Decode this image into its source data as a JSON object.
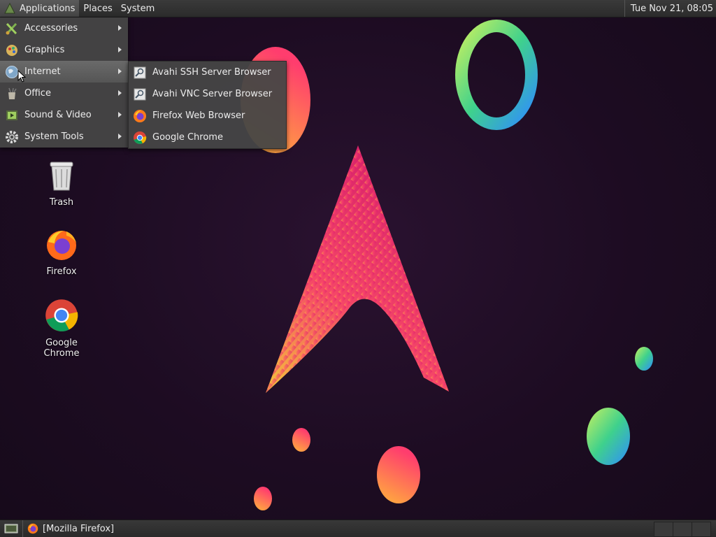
{
  "top_panel": {
    "menus": [
      {
        "label": "Applications",
        "active": true
      },
      {
        "label": "Places"
      },
      {
        "label": "System"
      }
    ],
    "clock": "Tue Nov 21, 08:05"
  },
  "applications_menu": {
    "items": [
      {
        "label": "Accessories",
        "icon": "accessories-icon"
      },
      {
        "label": "Graphics",
        "icon": "graphics-icon"
      },
      {
        "label": "Internet",
        "icon": "internet-globe-icon",
        "active": true
      },
      {
        "label": "Office",
        "icon": "office-icon"
      },
      {
        "label": "Sound & Video",
        "icon": "sound-video-icon"
      },
      {
        "label": "System Tools",
        "icon": "system-tools-gear-icon"
      }
    ]
  },
  "internet_submenu": {
    "items": [
      {
        "label": "Avahi SSH Server Browser",
        "icon": "avahi-ssh-icon"
      },
      {
        "label": "Avahi VNC Server Browser",
        "icon": "avahi-vnc-icon"
      },
      {
        "label": "Firefox Web Browser",
        "icon": "firefox-icon"
      },
      {
        "label": "Google Chrome",
        "icon": "chrome-icon"
      }
    ]
  },
  "desktop_icons": [
    {
      "label": "Trash",
      "icon": "trash-icon"
    },
    {
      "label": "Firefox",
      "icon": "firefox-icon"
    },
    {
      "label": "Google Chrome",
      "icon": "chrome-icon"
    }
  ],
  "bottom_panel": {
    "task": "[Mozilla Firefox]"
  }
}
